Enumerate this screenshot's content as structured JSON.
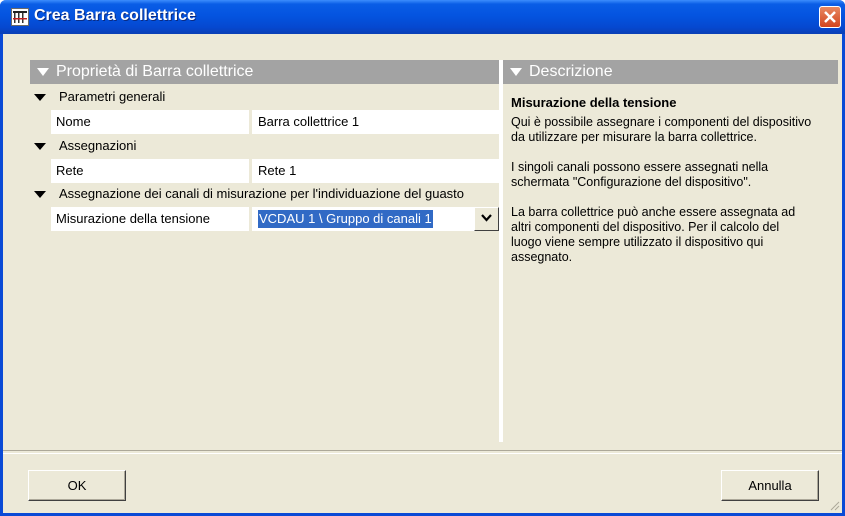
{
  "window": {
    "title": "Crea Barra collettrice",
    "icon": "bus-bar-app-icon",
    "close_icon": "close-icon"
  },
  "properties_panel": {
    "header": "Proprietà di Barra collettrice",
    "groups": [
      {
        "label": "Parametri generali",
        "rows": [
          {
            "name": "Nome",
            "value": "Barra collettrice 1"
          }
        ]
      },
      {
        "label": "Assegnazioni",
        "rows": [
          {
            "name": "Rete",
            "value": "Rete 1"
          }
        ]
      },
      {
        "label": "Assegnazione dei canali di misurazione per l'individuazione del guasto",
        "rows": [
          {
            "name": "Misurazione della tensione",
            "value": "VCDAU 1 \\ Gruppo di canali 1"
          }
        ]
      }
    ]
  },
  "description_panel": {
    "header": "Descrizione",
    "title": "Misurazione della tensione",
    "body": "Qui è possibile assegnare i componenti del dispositivo\nda utilizzare per misurare la barra collettrice.\n\nI singoli canali possono essere assegnati nella\nschermata \"Configurazione del dispositivo\".\n\nLa barra collettrice può anche essere assegnata ad\naltri componenti del dispositivo. Per il calcolo del\nluogo viene sempre utilizzato il dispositivo qui\nassegnato."
  },
  "buttons": {
    "ok": "OK",
    "cancel": "Annulla"
  },
  "colors": {
    "title_bar": "#0454e0",
    "panel_header": "#a3a3a3",
    "selection": "#316ac5",
    "dialog_bg": "#ece9d8"
  }
}
